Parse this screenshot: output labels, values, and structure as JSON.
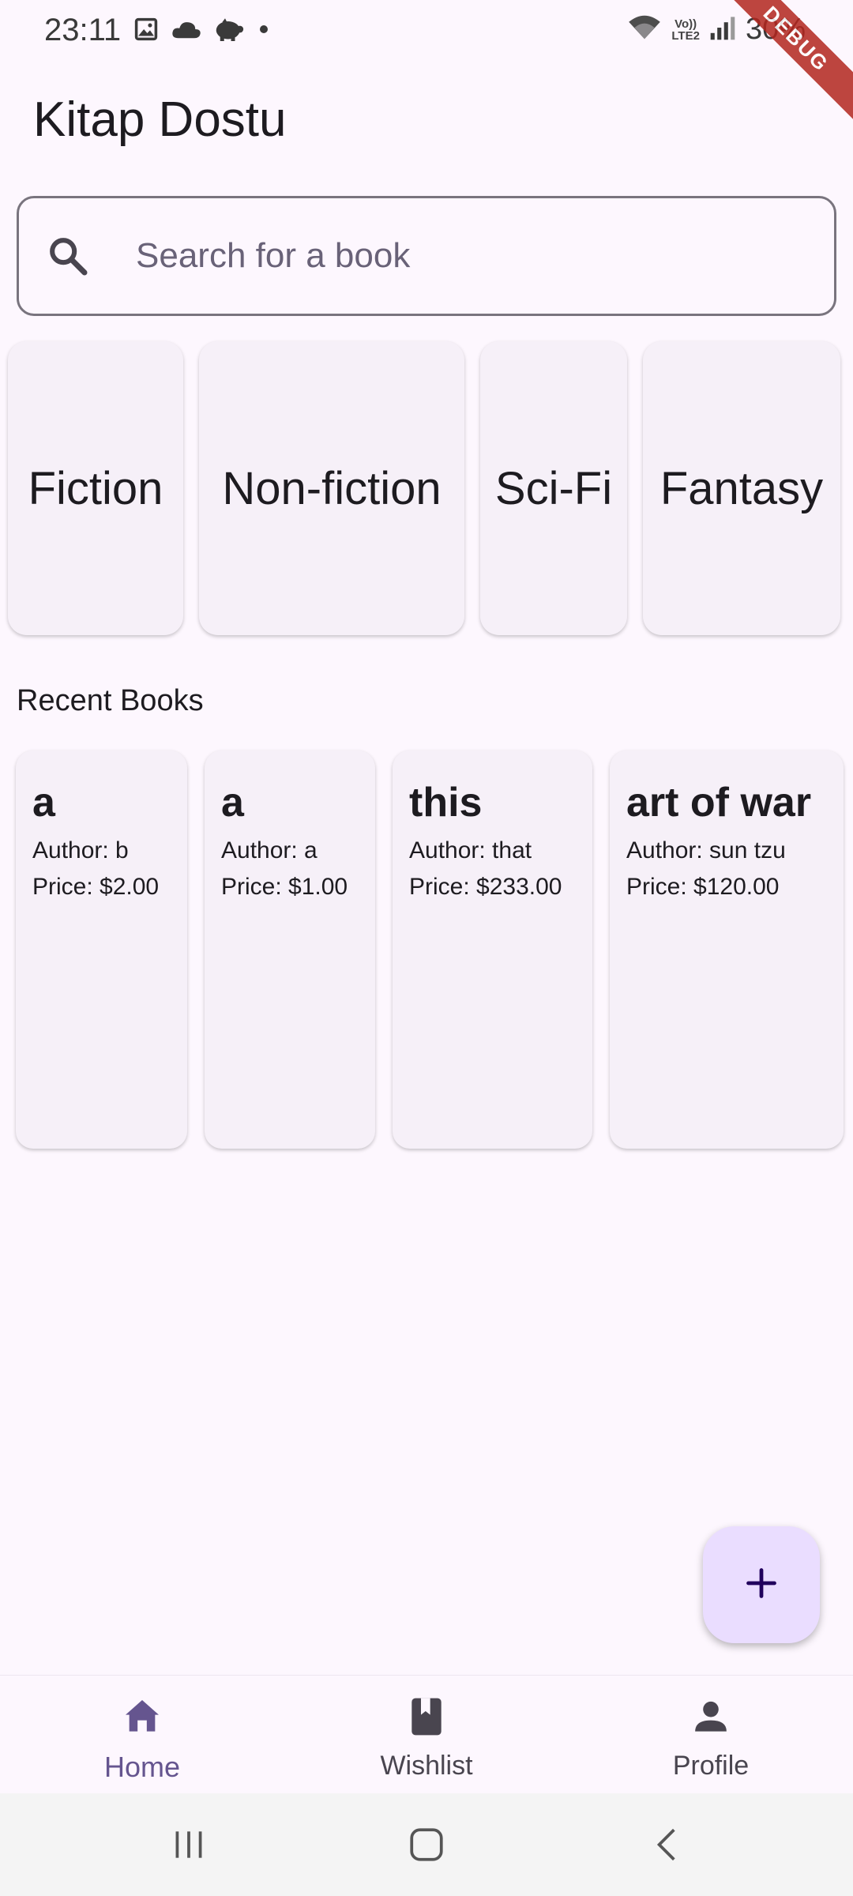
{
  "status_bar": {
    "time": "23:11",
    "battery": "30%",
    "lte_top": "Vo))",
    "lte_bottom": "LTE2",
    "debug_banner": "DEBUG"
  },
  "app": {
    "title": "Kitap Dostu"
  },
  "search": {
    "placeholder": "Search for a book",
    "value": ""
  },
  "categories": [
    {
      "label": "Fiction"
    },
    {
      "label": "Non-fiction"
    },
    {
      "label": "Sci-Fi"
    },
    {
      "label": "Fantasy"
    }
  ],
  "recent": {
    "title": "Recent Books",
    "books": [
      {
        "title": "a",
        "author": "Author: b",
        "price": "Price: $2.00"
      },
      {
        "title": "a",
        "author": "Author: a",
        "price": "Price: $1.00"
      },
      {
        "title": "this",
        "author": "Author: that",
        "price": "Price: $233.00"
      },
      {
        "title": "art of war",
        "author": "Author: sun tzu",
        "price": "Price: $120.00"
      }
    ]
  },
  "fab": {
    "icon": "plus-icon"
  },
  "bottom_nav": {
    "items": [
      {
        "label": "Home",
        "icon": "home-icon",
        "active": true
      },
      {
        "label": "Wishlist",
        "icon": "bookmark-book-icon",
        "active": false
      },
      {
        "label": "Profile",
        "icon": "person-icon",
        "active": false
      }
    ]
  },
  "colors": {
    "background": "#fdf7fe",
    "card": "#f6f0f8",
    "accent": "#65558f",
    "fab": "#eaddff",
    "outline": "#79747e"
  }
}
